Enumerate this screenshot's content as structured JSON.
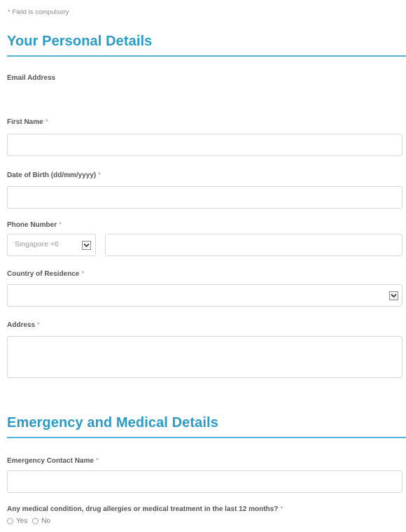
{
  "form": {
    "compulsory_note": "* Field is compulsory",
    "required_mark": "*"
  },
  "personal": {
    "title": "Your Personal Details",
    "email_label": "Email Address",
    "first_name_label": "First Name",
    "first_name_value": "",
    "dob_label": "Date of Birth (dd/mm/yyyy)",
    "dob_value": "",
    "phone_label": "Phone Number",
    "phone_country_code": "Singapore +6",
    "phone_value": "",
    "country_label": "Country of Residence",
    "country_value": "",
    "address_label": "Address",
    "address_value": ""
  },
  "emergency": {
    "title": "Emergency and Medical Details",
    "contact_name_label": "Emergency Contact Name",
    "contact_name_value": "",
    "medical_question": "Any medical condition, drug allergies or medical treatment in the last 12 months?",
    "options": [
      "Yes",
      "No"
    ]
  },
  "icons": {
    "dropdown": "chevron-down-icon",
    "radio": "radio-unchecked-icon"
  },
  "colors": {
    "heading": "#2a9bc7",
    "rule": "#4fb3d9",
    "border": "#d6d6d6"
  }
}
